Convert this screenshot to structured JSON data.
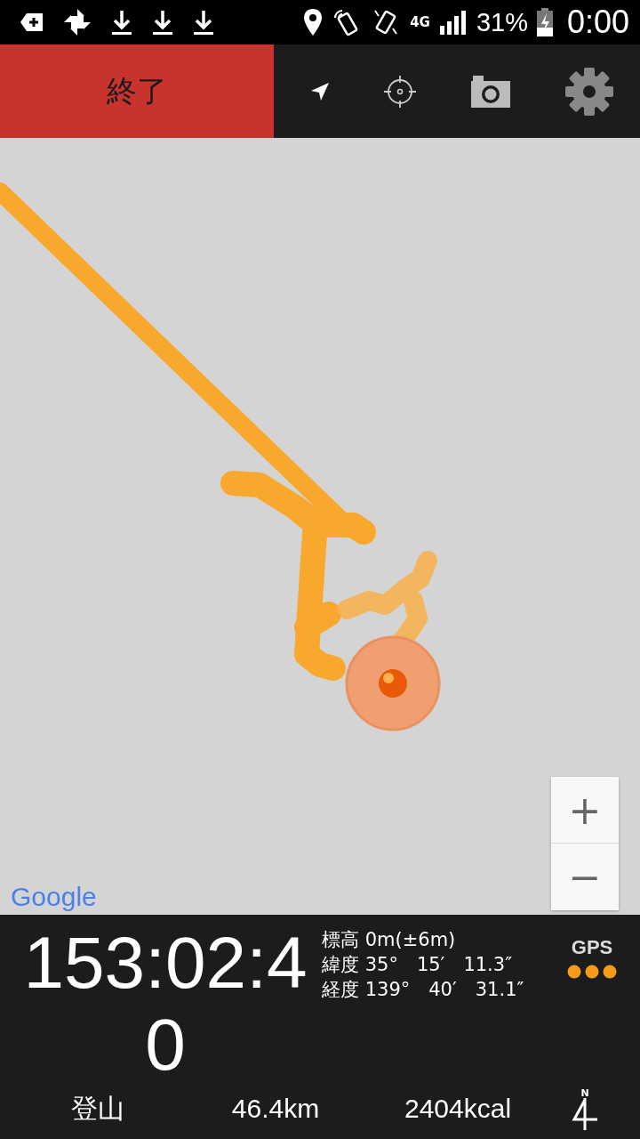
{
  "status_bar": {
    "network": "4G",
    "battery": "31%",
    "time": "0:00"
  },
  "toolbar": {
    "end_button": "終了"
  },
  "map": {
    "logo": "Google",
    "zoom_in": "+",
    "zoom_out": "−"
  },
  "panel": {
    "elapsed": "153:02:40",
    "info": [
      "標高 0m(±6m)",
      "緯度 35°　15′　11.3″",
      "経度 139°　40′　31.1″"
    ],
    "gps_label": "GPS",
    "activity": "登山",
    "distance": "46.4km",
    "calories": "2404kcal",
    "compass_north": "N"
  }
}
